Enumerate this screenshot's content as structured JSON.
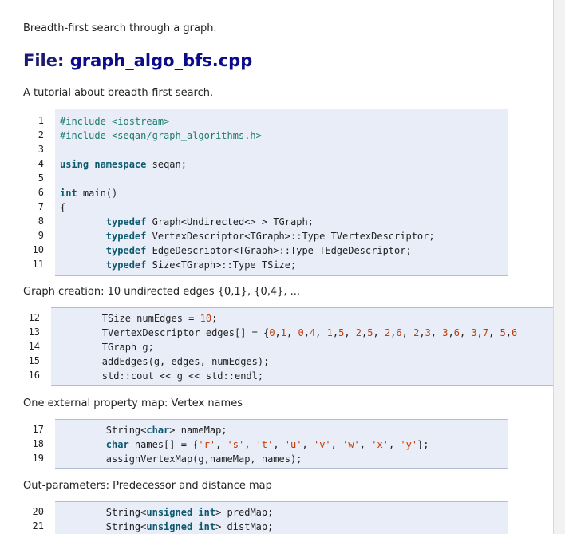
{
  "intro": "Breadth-first search through a graph.",
  "file_heading": {
    "prefix": "File: ",
    "name": "graph_algo_bfs.cpp"
  },
  "sections": [
    {
      "desc": "A tutorial about breadth-first search.",
      "lines": [
        {
          "n": "1",
          "tokens": [
            {
              "t": "#include <iostream>",
              "c": "pp"
            }
          ]
        },
        {
          "n": "2",
          "tokens": [
            {
              "t": "#include <seqan/graph_algorithms.h>",
              "c": "pp"
            }
          ]
        },
        {
          "n": "3",
          "tokens": []
        },
        {
          "n": "4",
          "tokens": [
            {
              "t": "using",
              "c": "kw"
            },
            {
              "t": " "
            },
            {
              "t": "namespace",
              "c": "kw"
            },
            {
              "t": " seqan;"
            }
          ]
        },
        {
          "n": "5",
          "tokens": []
        },
        {
          "n": "6",
          "tokens": [
            {
              "t": "int",
              "c": "kw"
            },
            {
              "t": " main()"
            }
          ]
        },
        {
          "n": "7",
          "tokens": [
            {
              "t": "{"
            }
          ]
        },
        {
          "n": "8",
          "tokens": [
            {
              "t": "        "
            },
            {
              "t": "typedef",
              "c": "kw"
            },
            {
              "t": " Graph<Undirected<> > TGraph;"
            }
          ]
        },
        {
          "n": "9",
          "tokens": [
            {
              "t": "        "
            },
            {
              "t": "typedef",
              "c": "kw"
            },
            {
              "t": " VertexDescriptor<TGraph>::Type TVertexDescriptor;"
            }
          ]
        },
        {
          "n": "10",
          "tokens": [
            {
              "t": "        "
            },
            {
              "t": "typedef",
              "c": "kw"
            },
            {
              "t": " EdgeDescriptor<TGraph>::Type TEdgeDescriptor;"
            }
          ]
        },
        {
          "n": "11",
          "tokens": [
            {
              "t": "        "
            },
            {
              "t": "typedef",
              "c": "kw"
            },
            {
              "t": " Size<TGraph>::Type TSize;"
            }
          ]
        }
      ]
    },
    {
      "desc": "Graph creation: 10 undirected edges {0,1}, {0,4}, ...",
      "lines": [
        {
          "n": "12",
          "tokens": [
            {
              "t": "        TSize numEdges = "
            },
            {
              "t": "10",
              "c": "num"
            },
            {
              "t": ";"
            }
          ]
        },
        {
          "n": "13",
          "tokens": [
            {
              "t": "        TVertexDescriptor edges[] = {"
            },
            {
              "t": "0",
              "c": "num"
            },
            {
              "t": ","
            },
            {
              "t": "1",
              "c": "num"
            },
            {
              "t": ", "
            },
            {
              "t": "0",
              "c": "num"
            },
            {
              "t": ","
            },
            {
              "t": "4",
              "c": "num"
            },
            {
              "t": ", "
            },
            {
              "t": "1",
              "c": "num"
            },
            {
              "t": ","
            },
            {
              "t": "5",
              "c": "num"
            },
            {
              "t": ", "
            },
            {
              "t": "2",
              "c": "num"
            },
            {
              "t": ","
            },
            {
              "t": "5",
              "c": "num"
            },
            {
              "t": ", "
            },
            {
              "t": "2",
              "c": "num"
            },
            {
              "t": ","
            },
            {
              "t": "6",
              "c": "num"
            },
            {
              "t": ", "
            },
            {
              "t": "2",
              "c": "num"
            },
            {
              "t": ","
            },
            {
              "t": "3",
              "c": "num"
            },
            {
              "t": ", "
            },
            {
              "t": "3",
              "c": "num"
            },
            {
              "t": ","
            },
            {
              "t": "6",
              "c": "num"
            },
            {
              "t": ", "
            },
            {
              "t": "3",
              "c": "num"
            },
            {
              "t": ","
            },
            {
              "t": "7",
              "c": "num"
            },
            {
              "t": ", "
            },
            {
              "t": "5",
              "c": "num"
            },
            {
              "t": ","
            },
            {
              "t": "6",
              "c": "num"
            }
          ]
        },
        {
          "n": "14",
          "tokens": [
            {
              "t": "        TGraph g;"
            }
          ]
        },
        {
          "n": "15",
          "tokens": [
            {
              "t": "        addEdges(g, edges, numEdges);"
            }
          ]
        },
        {
          "n": "16",
          "tokens": [
            {
              "t": "        std::cout << g << std::endl;"
            }
          ]
        }
      ]
    },
    {
      "desc": "One external property map: Vertex names",
      "lines": [
        {
          "n": "17",
          "tokens": [
            {
              "t": "        String<"
            },
            {
              "t": "char",
              "c": "kw"
            },
            {
              "t": "> nameMap;"
            }
          ]
        },
        {
          "n": "18",
          "tokens": [
            {
              "t": "        "
            },
            {
              "t": "char",
              "c": "kw"
            },
            {
              "t": " names[] = {"
            },
            {
              "t": "'r'",
              "c": "str"
            },
            {
              "t": ", "
            },
            {
              "t": "'s'",
              "c": "str"
            },
            {
              "t": ", "
            },
            {
              "t": "'t'",
              "c": "str"
            },
            {
              "t": ", "
            },
            {
              "t": "'u'",
              "c": "str"
            },
            {
              "t": ", "
            },
            {
              "t": "'v'",
              "c": "str"
            },
            {
              "t": ", "
            },
            {
              "t": "'w'",
              "c": "str"
            },
            {
              "t": ", "
            },
            {
              "t": "'x'",
              "c": "str"
            },
            {
              "t": ", "
            },
            {
              "t": "'y'",
              "c": "str"
            },
            {
              "t": "};"
            }
          ]
        },
        {
          "n": "19",
          "tokens": [
            {
              "t": "        assignVertexMap(g,nameMap, names);"
            }
          ]
        }
      ]
    },
    {
      "desc": "Out-parameters: Predecessor and distance map",
      "lines": [
        {
          "n": "20",
          "tokens": [
            {
              "t": "        String<"
            },
            {
              "t": "unsigned",
              "c": "kw"
            },
            {
              "t": " "
            },
            {
              "t": "int",
              "c": "kw"
            },
            {
              "t": "> predMap;"
            }
          ]
        },
        {
          "n": "21",
          "tokens": [
            {
              "t": "        String<"
            },
            {
              "t": "unsigned",
              "c": "kw"
            },
            {
              "t": " "
            },
            {
              "t": "int",
              "c": "kw"
            },
            {
              "t": "> distMap;"
            }
          ]
        }
      ]
    }
  ]
}
